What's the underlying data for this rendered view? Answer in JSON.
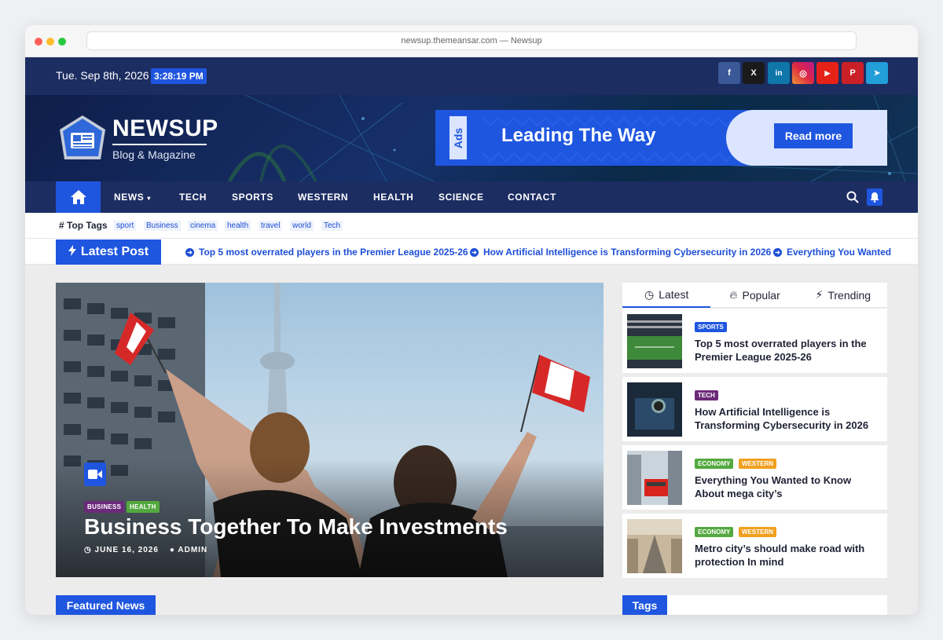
{
  "browser": {
    "url_title": "newsup.themeansar.com — Newsup"
  },
  "topbar": {
    "date": "Tue. Sep 8th, 2026",
    "time": "3:28:19 PM",
    "social": [
      {
        "name": "facebook-icon",
        "glyph": "f",
        "color": "#3b5998"
      },
      {
        "name": "x-icon",
        "glyph": "X",
        "color": "#1a1a1a"
      },
      {
        "name": "linkedin-icon",
        "glyph": "in",
        "color": "#0e76a8"
      },
      {
        "name": "instagram-icon",
        "glyph": "◎",
        "color": "#c13584"
      },
      {
        "name": "youtube-icon",
        "glyph": "▶",
        "color": "#e62117"
      },
      {
        "name": "pinterest-icon",
        "glyph": "P",
        "color": "#cb2027"
      },
      {
        "name": "telegram-icon",
        "glyph": "➤",
        "color": "#229ed9"
      }
    ]
  },
  "header": {
    "logo_title": "NEWSUP",
    "logo_subtitle": "Blog & Magazine",
    "ad": {
      "tag": "Ads",
      "headline": "Leading The Way",
      "button": "Read more"
    }
  },
  "nav": {
    "items": [
      "NEWS",
      "TECH",
      "SPORTS",
      "WESTERN",
      "HEALTH",
      "SCIENCE",
      "CONTACT"
    ]
  },
  "tags": {
    "label": "Top Tags",
    "items": [
      "sport",
      "Business",
      "cinema",
      "health",
      "travel",
      "world",
      "Tech"
    ]
  },
  "latest": {
    "label": "Latest Post",
    "ticker": [
      "Top 5 most overrated players in the Premier League 2025-26",
      "How Artificial Intelligence is Transforming Cybersecurity in 2026",
      "Everything You Wanted"
    ]
  },
  "hero": {
    "categories": [
      "BUSINESS",
      "HEALTH"
    ],
    "title": "Business Together To Make Investments",
    "date": "JUNE 16, 2026",
    "author": "ADMIN"
  },
  "sidebar": {
    "tabs": [
      "Latest",
      "Popular",
      "Trending"
    ],
    "posts": [
      {
        "cats": [
          "SPORTS"
        ],
        "title": "Top 5 most overrated players in the Premier League 2025-26"
      },
      {
        "cats": [
          "TECH"
        ],
        "title": "How Artificial Intelligence is Transforming Cybersecurity in 2026"
      },
      {
        "cats": [
          "ECONOMY",
          "WESTERN"
        ],
        "title": "Everything You Wanted to Know About mega city’s"
      },
      {
        "cats": [
          "ECONOMY",
          "WESTERN"
        ],
        "title": "Metro city’s should make road with protection In mind"
      }
    ]
  },
  "sections": {
    "featured": "Featured News",
    "tags": "Tags"
  },
  "colors": {
    "accent": "#1f56e0",
    "navy": "#1c2d62",
    "business": "#6c2a7a",
    "health": "#53a93f",
    "economy": "#53a93f",
    "western": "#f0a020",
    "tech": "#6c2a7a",
    "sports": "#1f56e0"
  }
}
